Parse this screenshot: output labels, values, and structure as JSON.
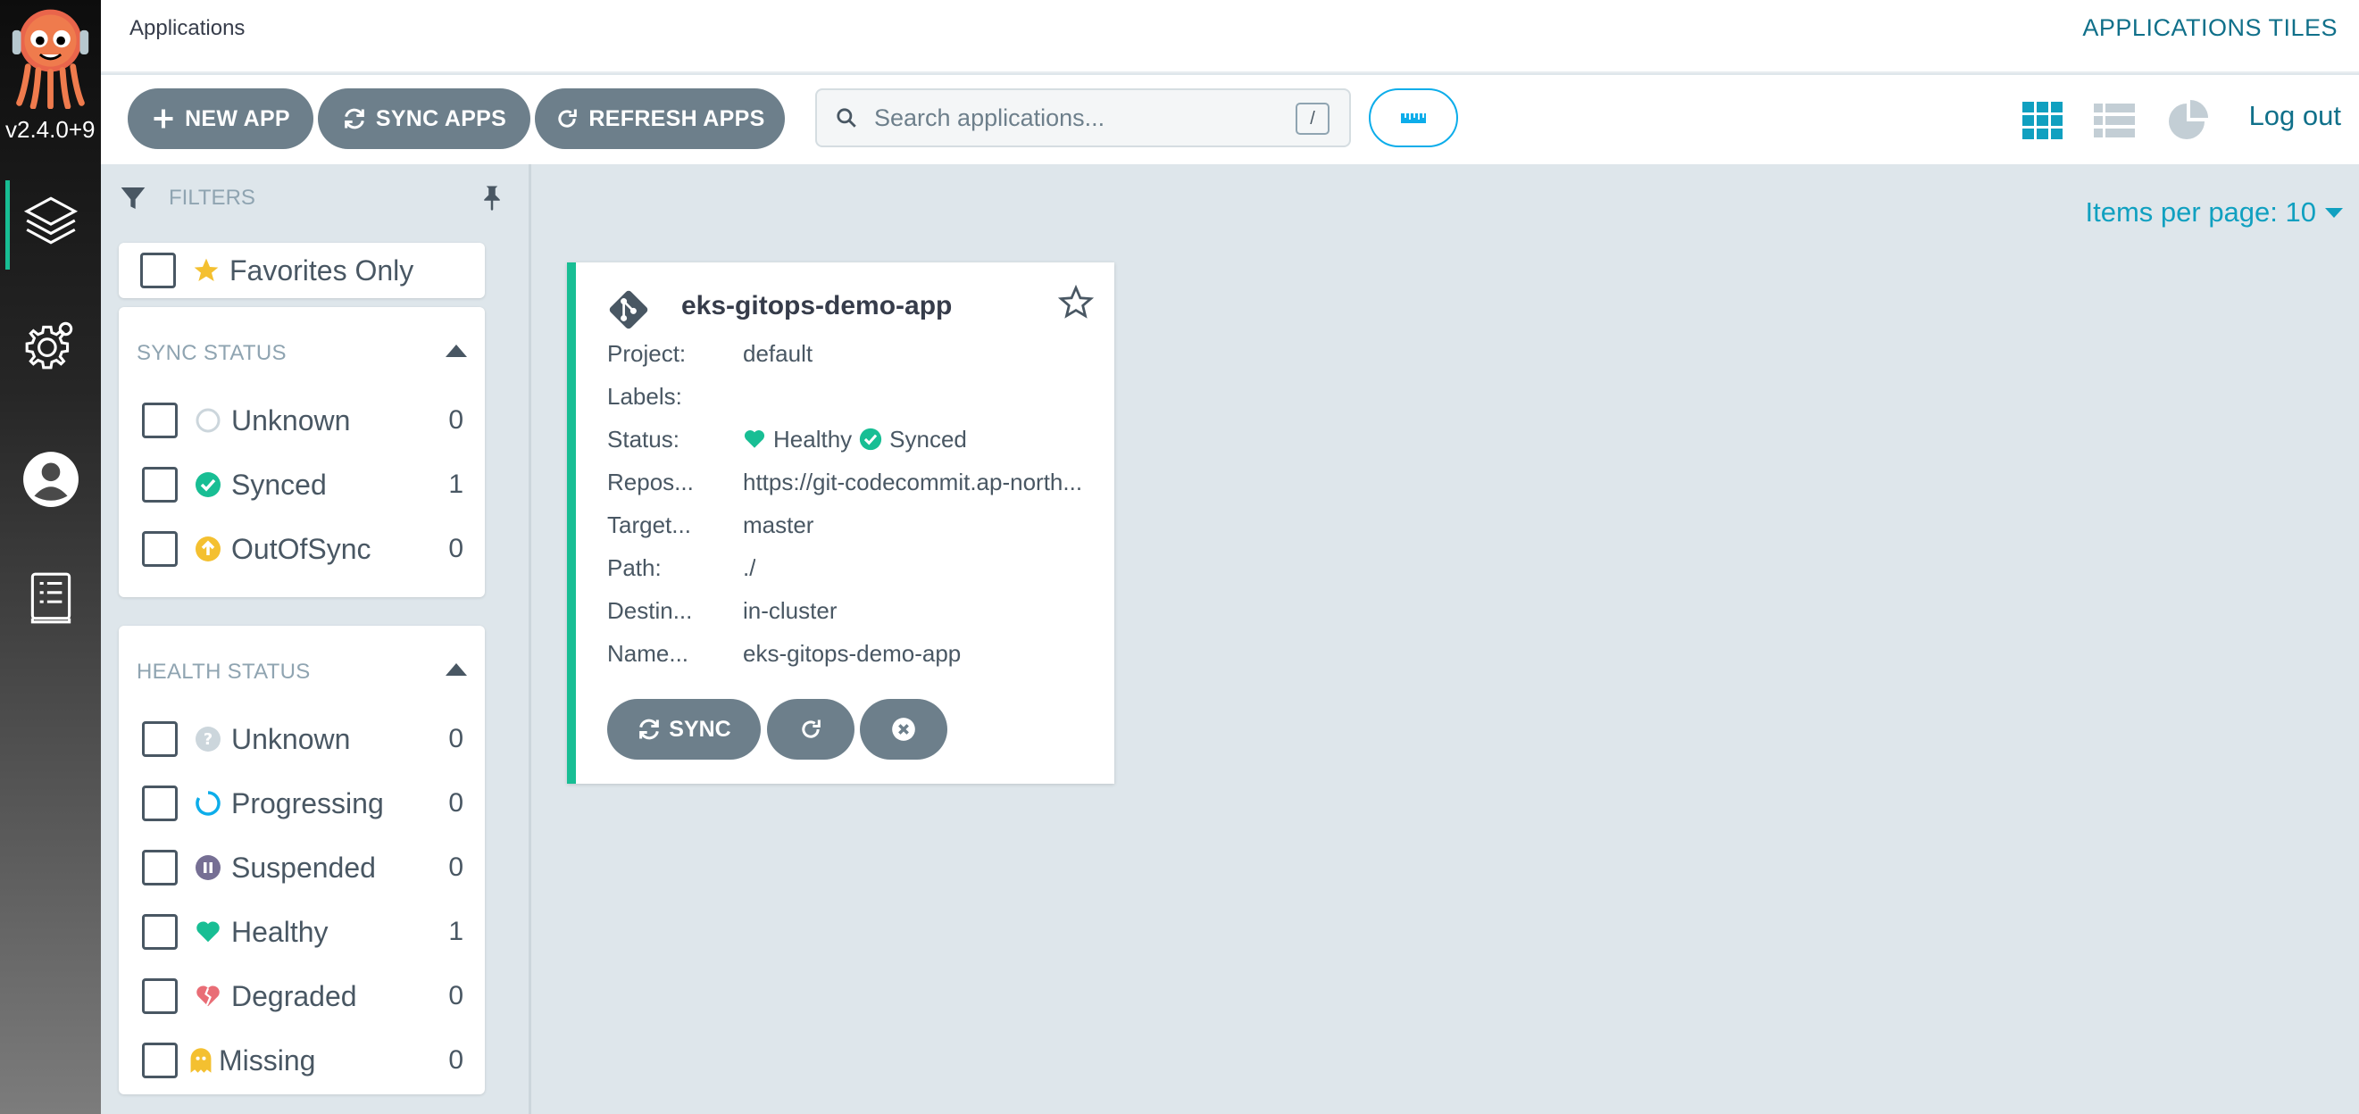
{
  "nav": {
    "version": "v2.4.0+9",
    "items": [
      "applications-icon",
      "settings-icon",
      "user-icon",
      "docs-icon"
    ]
  },
  "header": {
    "breadcrumb": "Applications",
    "view_title": "APPLICATIONS TILES"
  },
  "toolbar": {
    "new_app": "NEW APP",
    "sync_apps": "SYNC APPS",
    "refresh_apps": "REFRESH APPS",
    "search_placeholder": "Search applications...",
    "search_shortcut": "/",
    "logout": "Log out"
  },
  "filters": {
    "title": "FILTERS",
    "favorites_label": "Favorites Only",
    "sync_status": {
      "title": "SYNC STATUS",
      "items": [
        {
          "label": "Unknown",
          "count": "0"
        },
        {
          "label": "Synced",
          "count": "1"
        },
        {
          "label": "OutOfSync",
          "count": "0"
        }
      ]
    },
    "health_status": {
      "title": "HEALTH STATUS",
      "items": [
        {
          "label": "Unknown",
          "count": "0"
        },
        {
          "label": "Progressing",
          "count": "0"
        },
        {
          "label": "Suspended",
          "count": "0"
        },
        {
          "label": "Healthy",
          "count": "1"
        },
        {
          "label": "Degraded",
          "count": "0"
        },
        {
          "label": "Missing",
          "count": "0"
        }
      ]
    }
  },
  "main": {
    "items_per_page": "Items per page: 10"
  },
  "app": {
    "name": "eks-gitops-demo-app",
    "fields": [
      {
        "key": "Project:",
        "value": "default"
      },
      {
        "key": "Labels:",
        "value": ""
      },
      {
        "key": "Status:",
        "value": ""
      },
      {
        "key": "Repos...",
        "value": "https://git-codecommit.ap-north..."
      },
      {
        "key": "Target...",
        "value": "master"
      },
      {
        "key": "Path:",
        "value": "./"
      },
      {
        "key": "Destin...",
        "value": "in-cluster"
      },
      {
        "key": "Name...",
        "value": "eks-gitops-demo-app"
      }
    ],
    "health": "Healthy",
    "sync": "Synced",
    "sync_button": "SYNC"
  },
  "colors": {
    "accent": "#18be94",
    "button": "#6d7f8b",
    "link": "#10708a",
    "healthy": "#18be94",
    "outofsync": "#f4c030",
    "degraded": "#e96d76",
    "progressing": "#0dadea",
    "suspended": "#766f94"
  }
}
